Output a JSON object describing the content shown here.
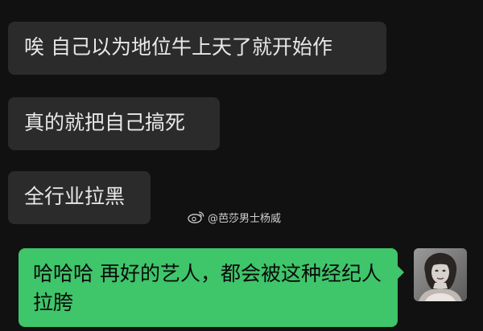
{
  "messages": [
    {
      "side": "incoming",
      "text": "唉 自己以为地位牛上天了就开始作"
    },
    {
      "side": "incoming",
      "text": "真的就把自己搞死"
    },
    {
      "side": "incoming",
      "text": "全行业拉黑"
    },
    {
      "side": "outgoing",
      "text": "哈哈哈 再好的艺人，都会被这种经纪人拉胯"
    }
  ],
  "watermark": {
    "icon": "weibo-icon",
    "text": "@芭莎男士杨威"
  },
  "colors": {
    "background": "#111111",
    "incoming_bubble": "#2b2b2b",
    "outgoing_bubble": "#3fc56a"
  }
}
